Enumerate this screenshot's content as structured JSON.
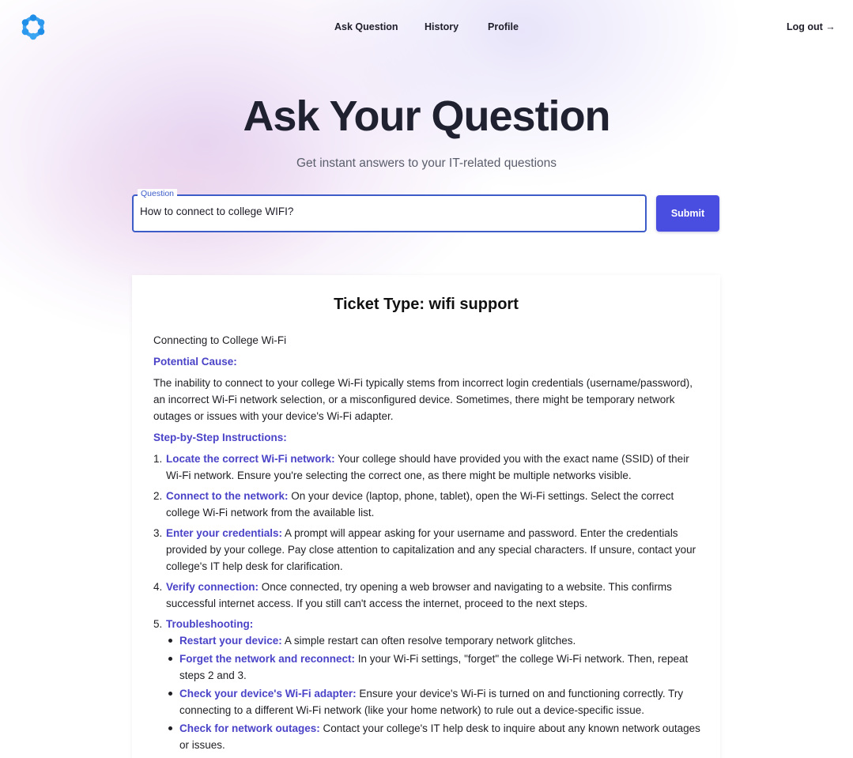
{
  "nav": {
    "logo_icon": "atom-ring-logo",
    "items": [
      {
        "label": "Ask Question"
      },
      {
        "label": "History"
      },
      {
        "label": "Profile"
      }
    ],
    "logout_label": "Log out →"
  },
  "hero": {
    "title": "Ask Your Question",
    "subtitle": "Get instant answers to your IT-related questions"
  },
  "question": {
    "label": "Question",
    "value": "How to connect to college WIFI?",
    "submit_label": "Submit"
  },
  "answer": {
    "ticket_title": "Ticket Type: wifi support",
    "intro": "Connecting to College Wi-Fi",
    "cause_heading": "Potential Cause:",
    "cause_text": "The inability to connect to your college Wi-Fi typically stems from incorrect login credentials (username/password), an incorrect Wi-Fi network selection, or a misconfigured device. Sometimes, there might be temporary network outages or issues with your device's Wi-Fi adapter.",
    "steps_heading": "Step-by-Step Instructions:",
    "steps": [
      {
        "num": "1.",
        "title": "Locate the correct Wi-Fi network:",
        "text": " Your college should have provided you with the exact name (SSID) of their Wi-Fi network. Ensure you're selecting the correct one, as there might be multiple networks visible."
      },
      {
        "num": "2.",
        "title": "Connect to the network:",
        "text": " On your device (laptop, phone, tablet), open the Wi-Fi settings. Select the correct college Wi-Fi network from the available list."
      },
      {
        "num": "3.",
        "title": "Enter your credentials:",
        "text": " A prompt will appear asking for your username and password. Enter the credentials provided by your college. Pay close attention to capitalization and any special characters. If unsure, contact your college's IT help desk for clarification."
      },
      {
        "num": "4.",
        "title": "Verify connection:",
        "text": " Once connected, try opening a web browser and navigating to a website. This confirms successful internet access. If you still can't access the internet, proceed to the next steps."
      },
      {
        "num": "5.",
        "title": "Troubleshooting:",
        "text": ""
      }
    ],
    "troubleshooting": [
      {
        "title": "Restart your device:",
        "text": " A simple restart can often resolve temporary network glitches."
      },
      {
        "title": "Forget the network and reconnect:",
        "text": " In your Wi-Fi settings, \"forget\" the college Wi-Fi network. Then, repeat steps 2 and 3."
      },
      {
        "title": "Check your device's Wi-Fi adapter:",
        "text": " Ensure your device's Wi-Fi is turned on and functioning correctly. Try connecting to a different Wi-Fi network (like your home network) to rule out a device-specific issue."
      },
      {
        "title": "Check for network outages:",
        "text": " Contact your college's IT help desk to inquire about any known network outages or issues."
      }
    ]
  },
  "colors": {
    "accent": "#4a4ee0",
    "heading_accent": "#4a43c8",
    "input_border": "#3d5cc8"
  }
}
